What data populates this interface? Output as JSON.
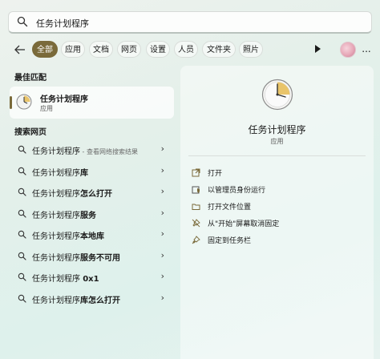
{
  "search": {
    "query": "任务计划程序"
  },
  "filters": {
    "items": [
      "全部",
      "应用",
      "文档",
      "网页",
      "设置",
      "人员",
      "文件夹",
      "照片"
    ],
    "more_label": "..."
  },
  "best_match": {
    "title": "最佳匹配",
    "name": "任务计划程序",
    "type": "应用"
  },
  "web": {
    "title": "搜索网页",
    "rows": [
      {
        "prefix": "任务计划程序",
        "bold": "",
        "suffix": " - 查看网络搜索结果"
      },
      {
        "prefix": "任务计划程序",
        "bold": "库",
        "suffix": ""
      },
      {
        "prefix": "任务计划程序",
        "bold": "怎么打开",
        "suffix": ""
      },
      {
        "prefix": "任务计划程序",
        "bold": "服务",
        "suffix": ""
      },
      {
        "prefix": "任务计划程序",
        "bold": "本地库",
        "suffix": ""
      },
      {
        "prefix": "任务计划程序",
        "bold": "服务不可用",
        "suffix": ""
      },
      {
        "prefix": "任务计划程序 ",
        "bold": "0x1",
        "suffix": ""
      },
      {
        "prefix": "任务计划程序",
        "bold": "库怎么打开",
        "suffix": ""
      }
    ]
  },
  "detail": {
    "name": "任务计划程序",
    "type": "应用",
    "actions": [
      "打开",
      "以管理员身份运行",
      "打开文件位置",
      "从\"开始\"屏幕取消固定",
      "固定到任务栏"
    ]
  },
  "colors": {
    "accent": "#7a6a3a"
  }
}
